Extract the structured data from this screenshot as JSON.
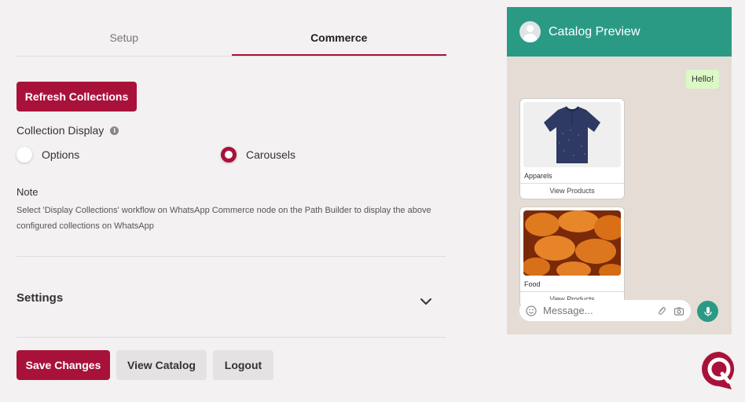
{
  "tabs": [
    {
      "label": "Setup",
      "active": false
    },
    {
      "label": "Commerce",
      "active": true
    }
  ],
  "refresh_label": "Refresh Collections",
  "collection_display": {
    "label": "Collection Display",
    "options": [
      {
        "label": "Options",
        "selected": false
      },
      {
        "label": "Carousels",
        "selected": true
      }
    ]
  },
  "note": {
    "title": "Note",
    "text": "Select 'Display Collections' workflow on WhatsApp Commerce node on the Path Builder to display the above configured collections on WhatsApp"
  },
  "settings_label": "Settings",
  "actions": {
    "save": "Save Changes",
    "view_catalog": "View Catalog",
    "logout": "Logout"
  },
  "preview": {
    "title": "Catalog Preview",
    "hello": "Hello!",
    "cards": [
      {
        "title": "Apparels",
        "button": "View Products"
      },
      {
        "title": "Food",
        "button": "View Products"
      }
    ],
    "message_placeholder": "Message..."
  },
  "colors": {
    "accent": "#a8123a",
    "whatsapp_green": "#2a9a85"
  }
}
